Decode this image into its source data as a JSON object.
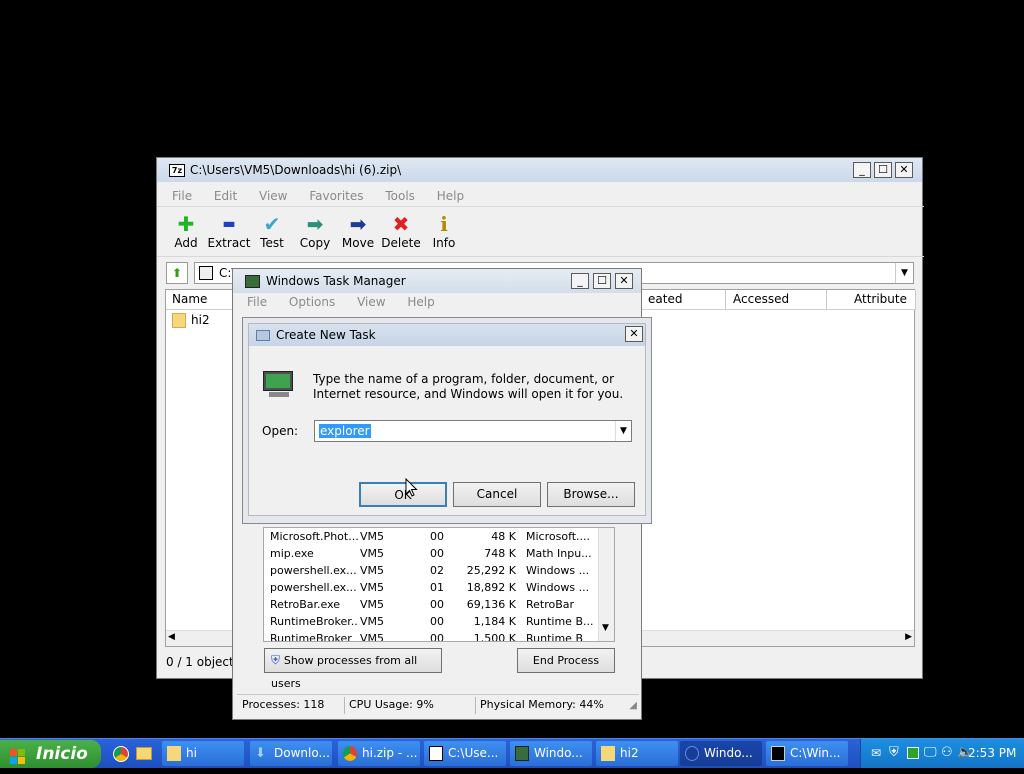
{
  "zip_window": {
    "title": "C:\\Users\\VM5\\Downloads\\hi (6).zip\\",
    "app_icon": "7z",
    "menu": [
      "File",
      "Edit",
      "View",
      "Favorites",
      "Tools",
      "Help"
    ],
    "toolbar": [
      {
        "label": "Add",
        "icon": "plus-icon",
        "glyph": "✚",
        "color": "#22b422"
      },
      {
        "label": "Extract",
        "icon": "minus-icon",
        "glyph": "▬",
        "color": "#1f3fbf"
      },
      {
        "label": "Test",
        "icon": "check-icon",
        "glyph": "✔",
        "color": "#3aa6c9"
      },
      {
        "label": "Copy",
        "icon": "arrow-right-green-icon",
        "glyph": "➡",
        "color": "#2f8f7a"
      },
      {
        "label": "Move",
        "icon": "arrow-right-blue-icon",
        "glyph": "➡",
        "color": "#1f3b8f"
      },
      {
        "label": "Delete",
        "icon": "x-icon",
        "glyph": "✖",
        "color": "#e02020"
      },
      {
        "label": "Info",
        "icon": "info-icon",
        "glyph": "i",
        "color": "#b08a00"
      }
    ],
    "address_value": "C:\\",
    "columns": {
      "name": "Name",
      "created": "eated",
      "accessed": "Accessed",
      "attributes": "Attribute"
    },
    "items": [
      {
        "name": "hi2"
      }
    ],
    "status": "0 / 1 object(s"
  },
  "task_manager": {
    "title": "Windows Task Manager",
    "menu": [
      "File",
      "Options",
      "View",
      "Help"
    ],
    "processes": [
      {
        "name": "Microsoft.Phot...",
        "user": "VM5",
        "cpu": "00",
        "mem": "48 K",
        "desc": "Microsoft...."
      },
      {
        "name": "mip.exe",
        "user": "VM5",
        "cpu": "00",
        "mem": "748 K",
        "desc": "Math Inpu..."
      },
      {
        "name": "powershell.ex...",
        "user": "VM5",
        "cpu": "02",
        "mem": "25,292 K",
        "desc": "Windows ..."
      },
      {
        "name": "powershell.ex...",
        "user": "VM5",
        "cpu": "01",
        "mem": "18,892 K",
        "desc": "Windows ..."
      },
      {
        "name": "RetroBar.exe",
        "user": "VM5",
        "cpu": "00",
        "mem": "69,136 K",
        "desc": "RetroBar"
      },
      {
        "name": "RuntimeBroker...",
        "user": "VM5",
        "cpu": "00",
        "mem": "1,184 K",
        "desc": "Runtime B..."
      },
      {
        "name": "RuntimeBroker",
        "user": "VM5",
        "cpu": "00",
        "mem": "1,500 K",
        "desc": "Runtime B"
      }
    ],
    "show_all_label": "Show processes from all users",
    "end_process_label": "End Process",
    "status_processes": "Processes: 118",
    "status_cpu": "CPU Usage: 9%",
    "status_memory": "Physical Memory: 44%"
  },
  "create_task": {
    "title": "Create New Task",
    "description": "Type the name of a program, folder, document, or Internet resource, and Windows will open it for you.",
    "open_label": "Open:",
    "open_value": "explorer",
    "ok_label": "OK",
    "cancel_label": "Cancel",
    "browse_label": "Browse..."
  },
  "taskbar": {
    "start_label": "Inicio",
    "tasks": [
      {
        "label": "hi",
        "icon": "folder-icon"
      },
      {
        "label": "Downlo...",
        "icon": "download-icon"
      },
      {
        "label": "hi.zip - ...",
        "icon": "chrome-icon"
      },
      {
        "label": "C:\\Use...",
        "icon": "7z-icon"
      },
      {
        "label": "Windo...",
        "icon": "taskmgr-icon"
      },
      {
        "label": "hi2",
        "icon": "folder-icon"
      },
      {
        "label": "Windo...",
        "icon": "windows-icon"
      },
      {
        "label": "C:\\Win...",
        "icon": "cmd-icon"
      }
    ],
    "clock": "2:53 PM"
  }
}
